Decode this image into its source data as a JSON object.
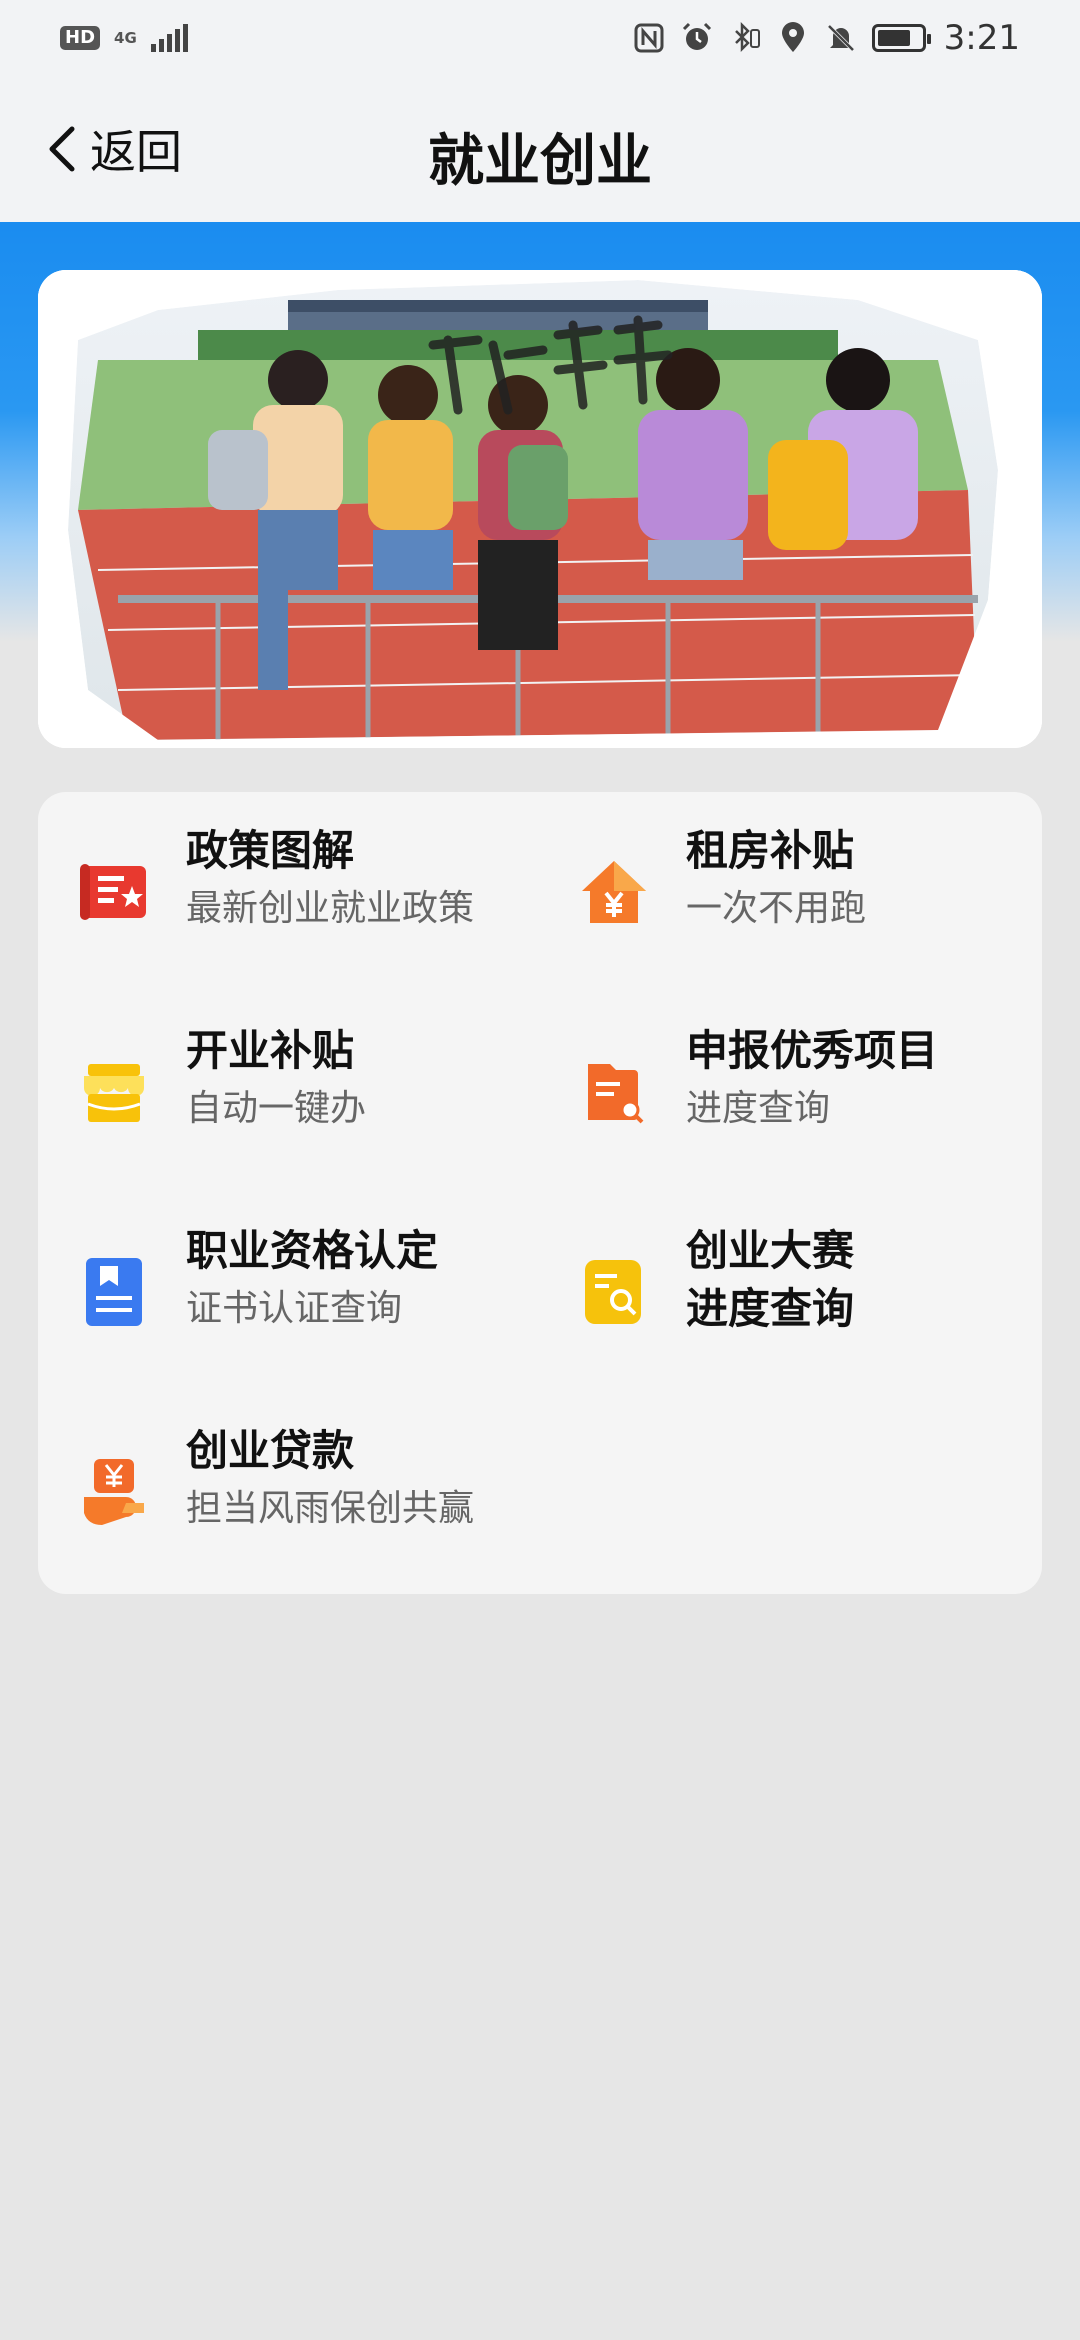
{
  "status_bar": {
    "hd": "HD",
    "network": "4G",
    "time": "3:21",
    "icons": [
      "nfc-icon",
      "alarm-icon",
      "bluetooth-icon",
      "location-icon",
      "mute-icon",
      "battery-icon"
    ]
  },
  "nav": {
    "back_label": "返回",
    "title": "就业创业"
  },
  "banner": {
    "image": "group-of-young-people-sitting-on-railing-photo"
  },
  "services": [
    {
      "title": "政策图解",
      "subtitle": "最新创业就业政策",
      "icon": "policy-document-icon",
      "color": "#e8392f"
    },
    {
      "title": "租房补贴",
      "subtitle": "一次不用跑",
      "icon": "house-yuan-icon",
      "color": "#f57a2a"
    },
    {
      "title": "开业补贴",
      "subtitle": "自动一键办",
      "icon": "storefront-icon",
      "color": "#f8c20a"
    },
    {
      "title": "申报优秀项目",
      "subtitle": "进度查询",
      "icon": "document-search-icon",
      "color": "#f26a2a"
    },
    {
      "title": "职业资格认定",
      "subtitle": "证书认证查询",
      "icon": "certificate-bookmark-icon",
      "color": "#3a7af0"
    },
    {
      "title": "创业大赛\n进度查询",
      "subtitle": "",
      "icon": "contest-search-icon",
      "color": "#f6c20c"
    },
    {
      "title": "创业贷款",
      "subtitle": "担当风雨保创共赢",
      "icon": "loan-hand-yuan-icon",
      "color": "#f26a2a"
    }
  ]
}
